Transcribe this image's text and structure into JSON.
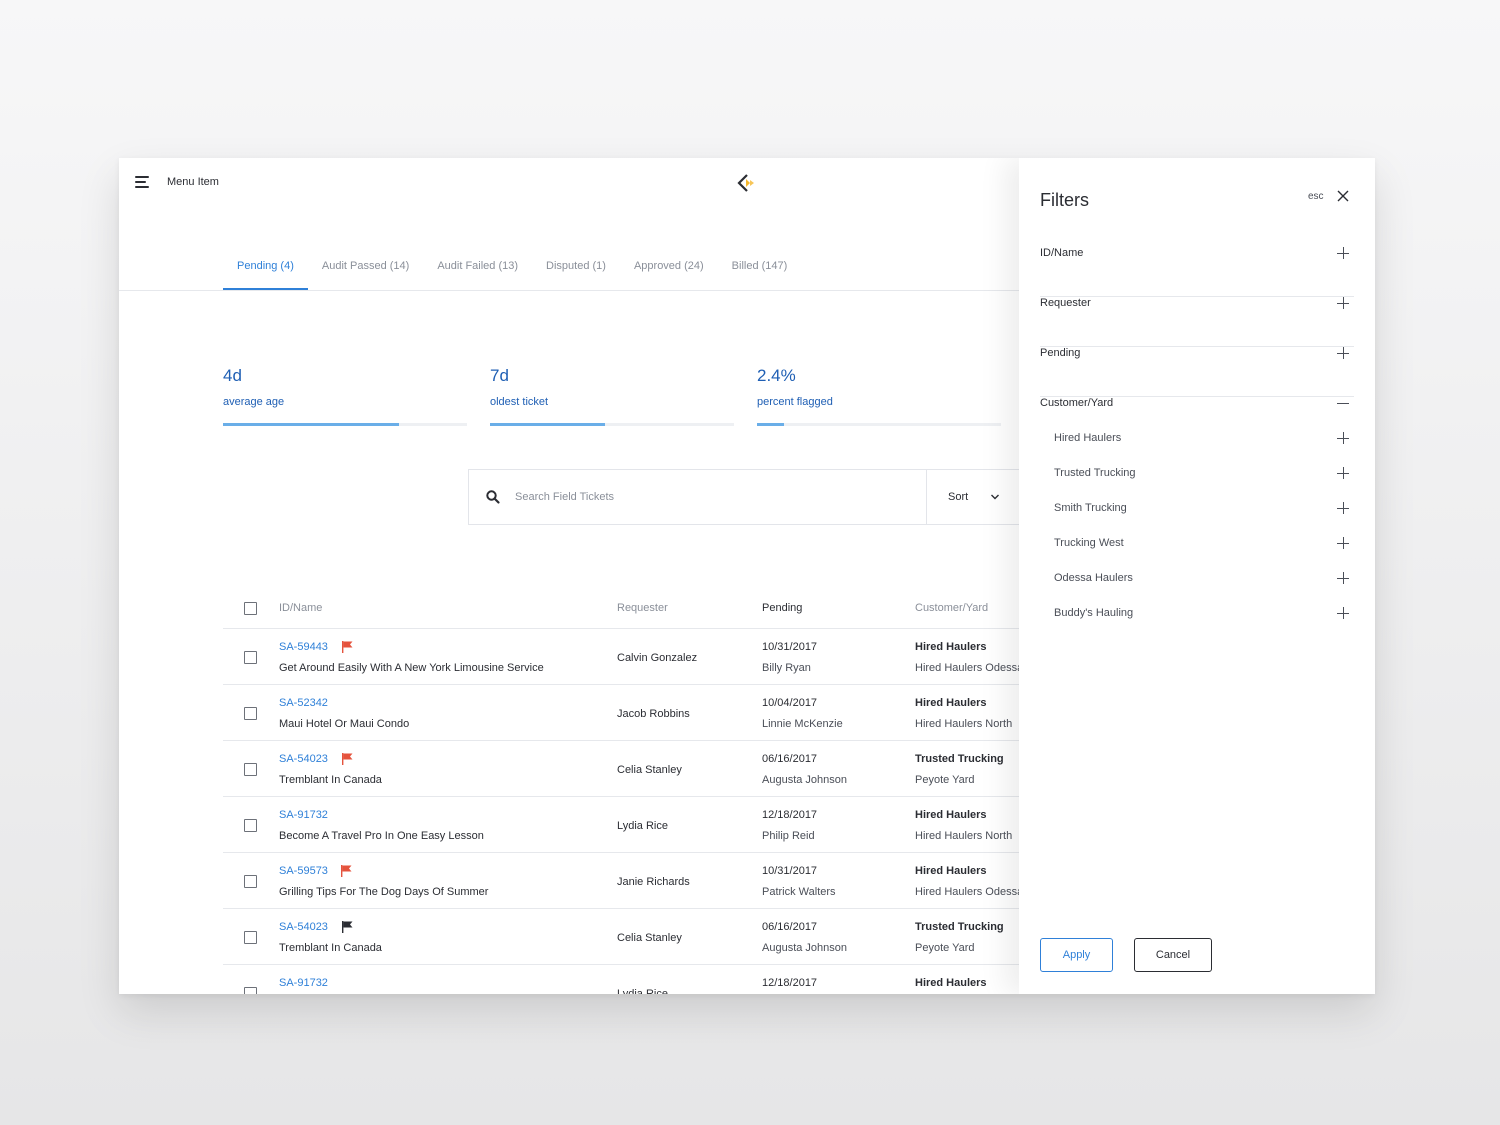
{
  "header": {
    "menu_label": "Menu Item"
  },
  "tabs": [
    {
      "label": "Pending (4)",
      "active": true
    },
    {
      "label": "Audit Passed (14)"
    },
    {
      "label": "Audit Failed (13)"
    },
    {
      "label": "Disputed (1)"
    },
    {
      "label": "Approved (24)"
    },
    {
      "label": "Billed (147)"
    }
  ],
  "stats": [
    {
      "value": "4d",
      "label": "average age",
      "fill": 0.72
    },
    {
      "value": "7d",
      "label": "oldest ticket",
      "fill": 0.47
    },
    {
      "value": "2.4%",
      "label": "percent flagged",
      "fill": 0.11
    }
  ],
  "search": {
    "placeholder": "Search Field Tickets",
    "sort_label": "Sort"
  },
  "table": {
    "columns": {
      "id_name": "ID/Name",
      "requester": "Requester",
      "pending": "Pending",
      "customer": "Customer/Yard"
    },
    "rows": [
      {
        "id": "SA-59443",
        "flag": "red",
        "name": "Get Around Easily With A New York Limousine Service",
        "requester": "Calvin Gonzalez",
        "date": "10/31/2017",
        "person": "Billy Ryan",
        "customer": "Hired Haulers",
        "yard": "Hired Haulers Odessa"
      },
      {
        "id": "SA-52342",
        "flag": "",
        "name": "Maui Hotel Or Maui Condo",
        "requester": "Jacob Robbins",
        "date": "10/04/2017",
        "person": "Linnie McKenzie",
        "customer": "Hired Haulers",
        "yard": "Hired Haulers North"
      },
      {
        "id": "SA-54023",
        "flag": "red",
        "name": "Tremblant In Canada",
        "requester": "Celia Stanley",
        "date": "06/16/2017",
        "person": "Augusta Johnson",
        "customer": "Trusted Trucking",
        "yard": "Peyote Yard"
      },
      {
        "id": "SA-91732",
        "flag": "",
        "name": "Become A Travel Pro In One Easy Lesson",
        "requester": "Lydia Rice",
        "date": "12/18/2017",
        "person": "Philip Reid",
        "customer": "Hired Haulers",
        "yard": "Hired Haulers North"
      },
      {
        "id": "SA-59573",
        "flag": "red",
        "name": "Grilling Tips For The Dog Days Of Summer",
        "requester": "Janie Richards",
        "date": "10/31/2017",
        "person": "Patrick Walters",
        "customer": "Hired Haulers",
        "yard": "Hired Haulers Odessa"
      },
      {
        "id": "SA-54023",
        "flag": "black",
        "name": "Tremblant In Canada",
        "requester": "Celia Stanley",
        "date": "06/16/2017",
        "person": "Augusta Johnson",
        "customer": "Trusted Trucking",
        "yard": "Peyote Yard"
      },
      {
        "id": "SA-91732",
        "flag": "",
        "name": "",
        "requester": "Lydia Rice",
        "date": "12/18/2017",
        "person": "",
        "customer": "Hired Haulers",
        "yard": ""
      }
    ]
  },
  "filters": {
    "title": "Filters",
    "esc_label": "esc",
    "sections": [
      {
        "label": "ID/Name",
        "expanded": false
      },
      {
        "label": "Requester",
        "expanded": false
      },
      {
        "label": "Pending",
        "expanded": false
      },
      {
        "label": "Customer/Yard",
        "expanded": true
      }
    ],
    "customer_items": [
      "Hired Haulers",
      "Trusted Trucking",
      "Smith Trucking",
      "Trucking West",
      "Odessa Haulers",
      "Buddy's Hauling"
    ],
    "apply_label": "Apply",
    "cancel_label": "Cancel"
  },
  "colors": {
    "accent": "#2f80d8",
    "stat_text": "#1f5fb4",
    "progress": "#6aaee8",
    "flag_red": "#e5533d",
    "flag_black": "#2b2d33"
  }
}
